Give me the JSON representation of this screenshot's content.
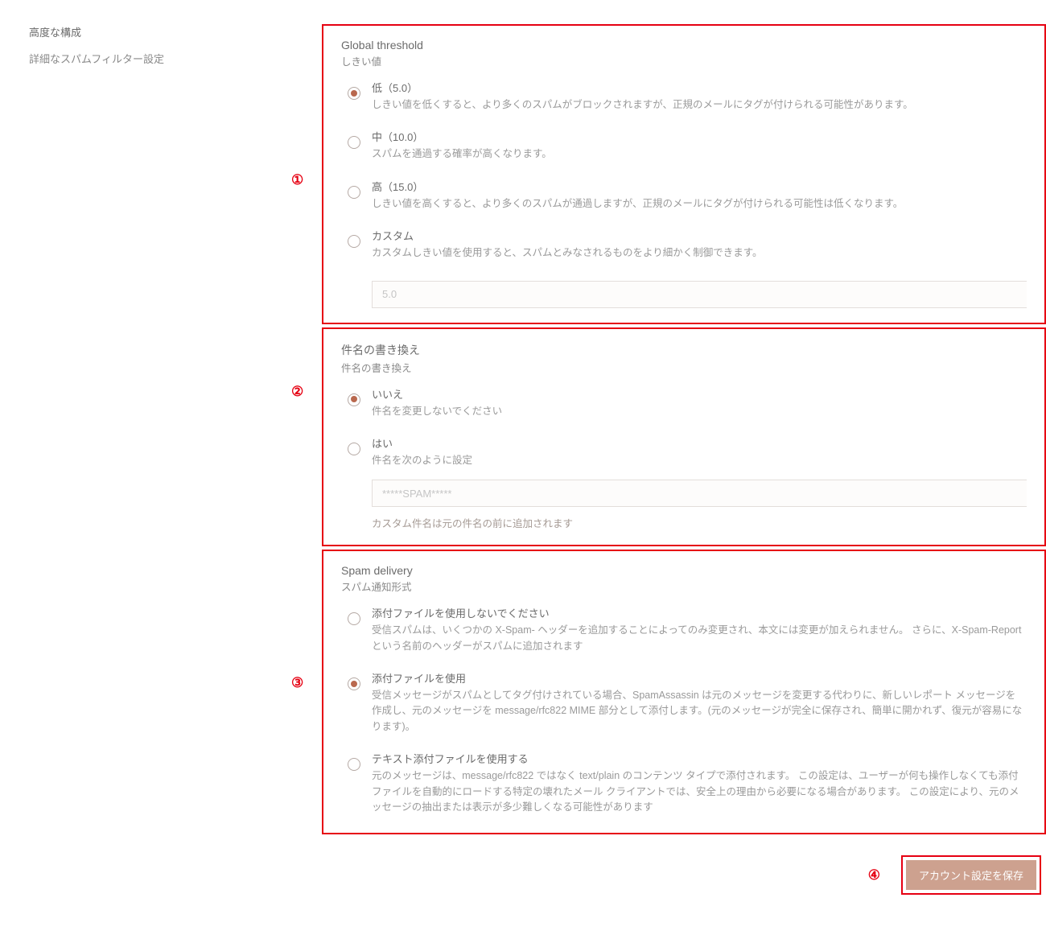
{
  "sidebar": {
    "title": "高度な構成",
    "subtitle": "詳細なスパムフィルター設定"
  },
  "annotations": {
    "n1": "①",
    "n2": "②",
    "n3": "③",
    "n4": "④"
  },
  "threshold": {
    "title": "Global threshold",
    "subtitle": "しきい値",
    "low": {
      "label": "低（5.0）",
      "desc": "しきい値を低くすると、より多くのスパムがブロックされますが、正規のメールにタグが付けられる可能性があります。"
    },
    "mid": {
      "label": "中（10.0）",
      "desc": "スパムを通過する確率が高くなります。"
    },
    "high": {
      "label": "高（15.0）",
      "desc": "しきい値を高くすると、より多くのスパムが通過しますが、正規のメールにタグが付けられる可能性は低くなります。"
    },
    "custom": {
      "label": "カスタム",
      "desc": "カスタムしきい値を使用すると、スパムとみなされるものをより細かく制御できます。",
      "placeholder": "5.0"
    }
  },
  "subject": {
    "title": "件名の書き換え",
    "subtitle": "件名の書き換え",
    "no": {
      "label": "いいえ",
      "desc": "件名を変更しないでください"
    },
    "yes": {
      "label": "はい",
      "desc": "件名を次のように設定",
      "placeholder": "*****SPAM*****",
      "note": "カスタム件名は元の件名の前に追加されます"
    }
  },
  "delivery": {
    "title": "Spam delivery",
    "subtitle": "スパム通知形式",
    "noattach": {
      "label": "添付ファイルを使用しないでください",
      "desc": "受信スパムは、いくつかの X-Spam- ヘッダーを追加することによってのみ変更され、本文には変更が加えられません。 さらに、X-Spam-Report という名前のヘッダーがスパムに追加されます"
    },
    "attach": {
      "label": "添付ファイルを使用",
      "desc": "受信メッセージがスパムとしてタグ付けされている場合、SpamAssassin は元のメッセージを変更する代わりに、新しいレポート メッセージを作成し、元のメッセージを message/rfc822 MIME 部分として添付します。(元のメッセージが完全に保存され、簡単に開かれず、復元が容易になります)。"
    },
    "text": {
      "label": "テキスト添付ファイルを使用する",
      "desc": "元のメッセージは、message/rfc822 ではなく text/plain のコンテンツ タイプで添付されます。 この設定は、ユーザーが何も操作しなくても添付ファイルを自動的にロードする特定の壊れたメール クライアントでは、安全上の理由から必要になる場合があります。 この設定により、元のメッセージの抽出または表示が多少難しくなる可能性があります"
    }
  },
  "save": {
    "label": "アカウント設定を保存"
  }
}
